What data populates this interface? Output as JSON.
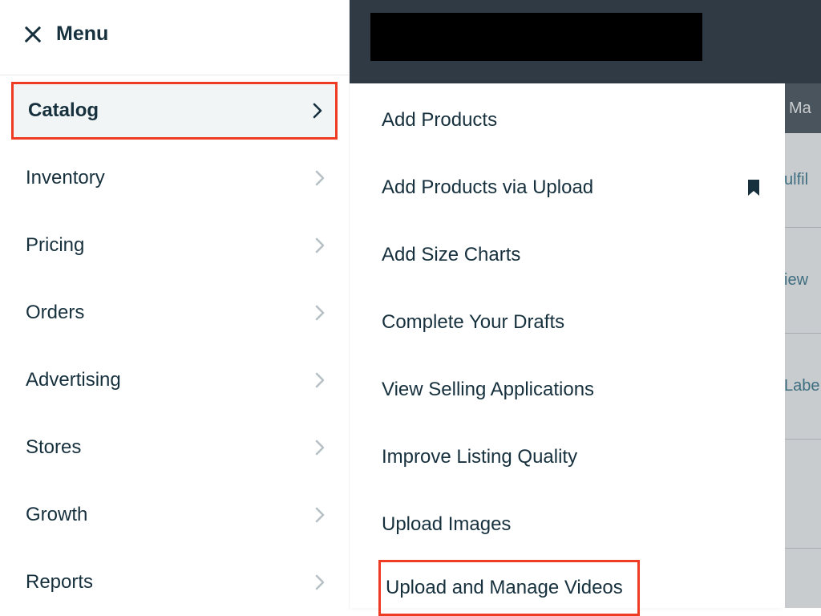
{
  "menu": {
    "title": "Menu",
    "items": [
      {
        "label": "Catalog",
        "highlighted": true
      },
      {
        "label": "Inventory"
      },
      {
        "label": "Pricing"
      },
      {
        "label": "Orders"
      },
      {
        "label": "Advertising"
      },
      {
        "label": "Stores"
      },
      {
        "label": "Growth"
      },
      {
        "label": "Reports"
      }
    ]
  },
  "flyout": {
    "items": [
      {
        "label": "Add Products"
      },
      {
        "label": "Add Products via Upload",
        "bookmarked": true
      },
      {
        "label": "Add Size Charts"
      },
      {
        "label": "Complete Your Drafts"
      },
      {
        "label": "View Selling Applications"
      },
      {
        "label": "Improve Listing Quality"
      },
      {
        "label": "Upload Images"
      },
      {
        "label": "Upload and Manage Videos",
        "highlighted": true
      }
    ]
  },
  "background": {
    "header_fragment": "Ma",
    "row1": "ulfil",
    "row2": "iew",
    "row3": "Labe"
  }
}
